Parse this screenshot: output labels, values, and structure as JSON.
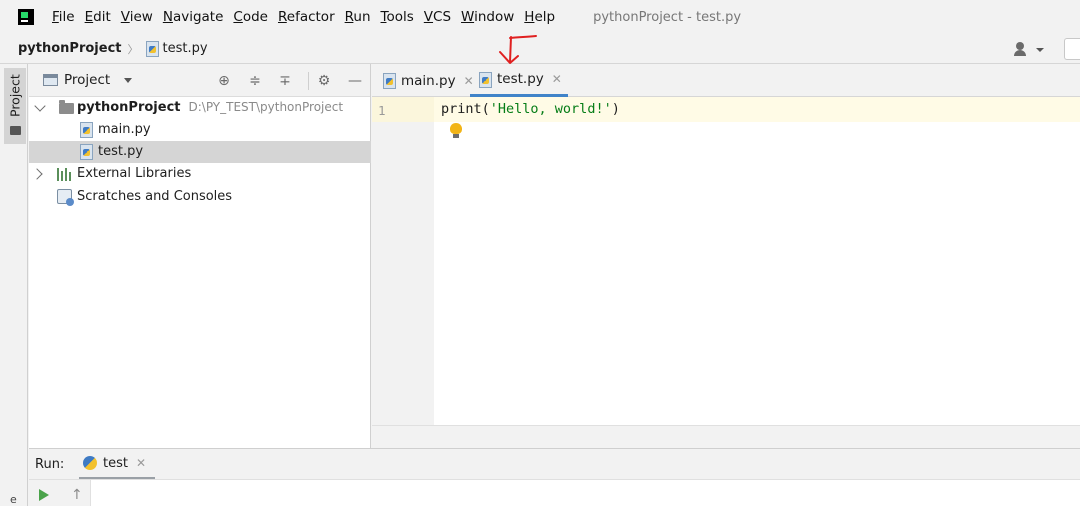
{
  "menubar": {
    "items": [
      "File",
      "Edit",
      "View",
      "Navigate",
      "Code",
      "Refactor",
      "Run",
      "Tools",
      "VCS",
      "Window",
      "Help"
    ],
    "window_title": "pythonProject - test.py"
  },
  "navbar": {
    "project": "pythonProject",
    "file": "test.py"
  },
  "tool_strip": {
    "project_tab": "Project",
    "bottom_char": "e"
  },
  "project_panel": {
    "title": "Project",
    "tree": {
      "root_name": "pythonProject",
      "root_path": "D:\\PY_TEST\\pythonProject",
      "files": [
        "main.py",
        "test.py"
      ],
      "external_libraries": "External Libraries",
      "scratches": "Scratches and Consoles"
    }
  },
  "editor": {
    "tabs": [
      {
        "label": "main.py",
        "active": false
      },
      {
        "label": "test.py",
        "active": true
      }
    ],
    "line_number": "1",
    "code_prefix": "print(",
    "code_string": "'Hello, world!'",
    "code_suffix": ")"
  },
  "run": {
    "label": "Run:",
    "tab": "test"
  },
  "colors": {
    "active_tab_underline": "#4083c9",
    "string_literal": "#067d17",
    "annotation_arrow": "#e02020"
  }
}
